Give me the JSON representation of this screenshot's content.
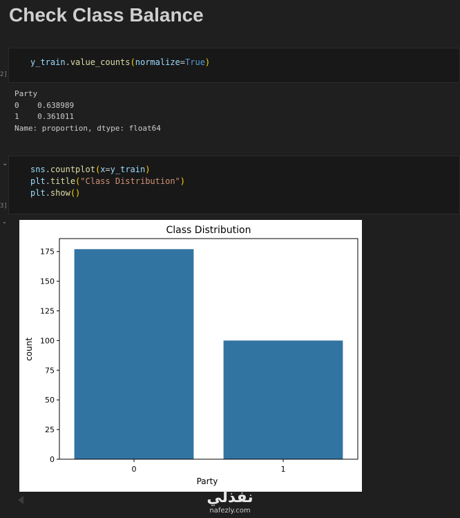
{
  "heading": "Check Class Balance",
  "cell1": {
    "exec_count": "2]",
    "code": {
      "a": "y_train",
      "b": ".",
      "c": "value_counts",
      "d": "(",
      "e": "normalize",
      "f": "=",
      "g": "True",
      "h": ")"
    },
    "output": [
      "Party",
      "0    0.638989",
      "1    0.361011",
      "Name: proportion, dtype: float64"
    ]
  },
  "cell2": {
    "exec_count": "3]",
    "line1": {
      "a": "sns",
      "b": ".",
      "c": "countplot",
      "d": "(",
      "e": "x",
      "f": "=",
      "g": "y_train",
      "h": ")"
    },
    "line2": {
      "a": "plt",
      "b": ".",
      "c": "title",
      "d": "(",
      "e": "\"Class Distribution\"",
      "f": ")"
    },
    "line3": {
      "a": "plt",
      "b": ".",
      "c": "show",
      "d": "()"
    }
  },
  "chart_data": {
    "type": "bar",
    "title": "Class Distribution",
    "xlabel": "Party",
    "ylabel": "count",
    "categories": [
      "0",
      "1"
    ],
    "values": [
      177,
      100
    ],
    "ylim": [
      0,
      185.9
    ],
    "yticks": [
      0,
      25,
      50,
      75,
      100,
      125,
      150,
      175
    ],
    "bar_color": "#3274a1",
    "grid": false
  },
  "watermark": {
    "logo": "نفذلي",
    "url": "nafezly.com"
  }
}
